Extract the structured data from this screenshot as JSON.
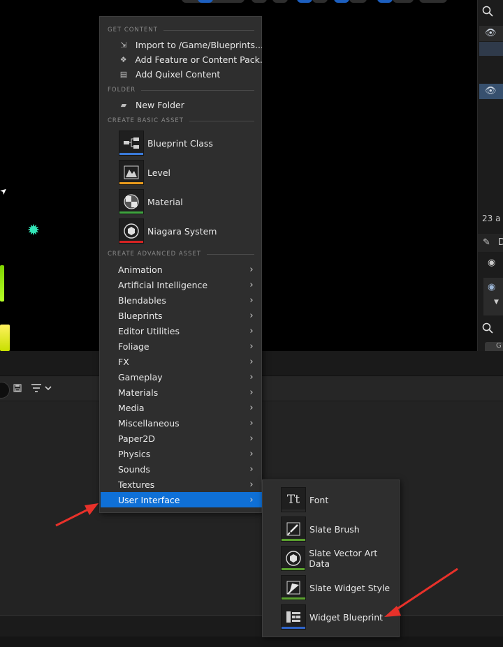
{
  "colors": {
    "menu_bg": "#2e2e2e",
    "highlight": "#0f70d7",
    "annotation": "#e8312a",
    "blueprint_bar": "#3a7ad9",
    "level_bar": "#e89a1c",
    "material_bar": "#3ea43e",
    "niagara_bar": "#d42323",
    "ui_green_bar": "#5aa12e",
    "widget_bar": "#2f64c9"
  },
  "right_panel": {
    "count_text": "23 a",
    "details_label": "D",
    "button_label": "G"
  },
  "menu": {
    "get_content": {
      "header": "GET CONTENT",
      "items": [
        {
          "label": "Import to /Game/Blueprints...",
          "icon": "import-icon"
        },
        {
          "label": "Add Feature or Content Pack...",
          "icon": "feature-pack-icon"
        },
        {
          "label": "Add Quixel Content",
          "icon": "quixel-icon"
        }
      ]
    },
    "folder": {
      "header": "FOLDER",
      "items": [
        {
          "label": "New Folder",
          "icon": "new-folder-icon"
        }
      ]
    },
    "basic_asset": {
      "header": "CREATE BASIC ASSET",
      "items": [
        {
          "label": "Blueprint Class",
          "icon": "blueprint-class-icon"
        },
        {
          "label": "Level",
          "icon": "level-icon"
        },
        {
          "label": "Material",
          "icon": "material-icon"
        },
        {
          "label": "Niagara System",
          "icon": "niagara-system-icon"
        }
      ]
    },
    "advanced_asset": {
      "header": "CREATE ADVANCED ASSET",
      "items": [
        {
          "label": "Animation"
        },
        {
          "label": "Artificial Intelligence"
        },
        {
          "label": "Blendables"
        },
        {
          "label": "Blueprints"
        },
        {
          "label": "Editor Utilities"
        },
        {
          "label": "Foliage"
        },
        {
          "label": "FX"
        },
        {
          "label": "Gameplay"
        },
        {
          "label": "Materials"
        },
        {
          "label": "Media"
        },
        {
          "label": "Miscellaneous"
        },
        {
          "label": "Paper2D"
        },
        {
          "label": "Physics"
        },
        {
          "label": "Sounds"
        },
        {
          "label": "Textures"
        },
        {
          "label": "User Interface",
          "active": true
        }
      ]
    }
  },
  "submenu": {
    "items": [
      {
        "label": "Font",
        "icon": "font-icon"
      },
      {
        "label": "Slate Brush",
        "icon": "slate-brush-icon"
      },
      {
        "label": "Slate Vector Art Data",
        "icon": "vector-art-icon"
      },
      {
        "label": "Slate Widget Style",
        "icon": "widget-style-icon"
      },
      {
        "label": "Widget Blueprint",
        "icon": "widget-blueprint-icon"
      }
    ]
  }
}
